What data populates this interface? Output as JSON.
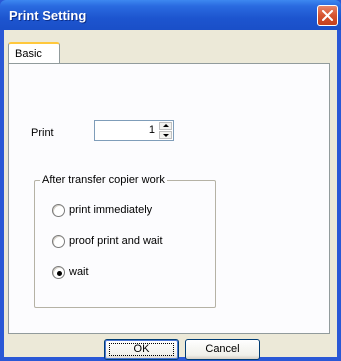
{
  "window": {
    "title": "Print Setting"
  },
  "tabs": [
    {
      "label": "Basic",
      "active": true
    }
  ],
  "print": {
    "label": "Print",
    "value": "1"
  },
  "group": {
    "label": "After transfer copier work",
    "options": [
      {
        "label": "print immediately",
        "checked": false
      },
      {
        "label": "proof print and wait",
        "checked": false
      },
      {
        "label": "wait",
        "checked": true
      }
    ]
  },
  "buttons": {
    "ok": "OK",
    "cancel": "Cancel"
  },
  "colors": {
    "titlebar": "#1a4fc8",
    "client": "#ece9d8",
    "panel": "#fcfcfe",
    "tab_highlight": "#ffc83c"
  },
  "icons": {
    "close": "close-icon"
  }
}
